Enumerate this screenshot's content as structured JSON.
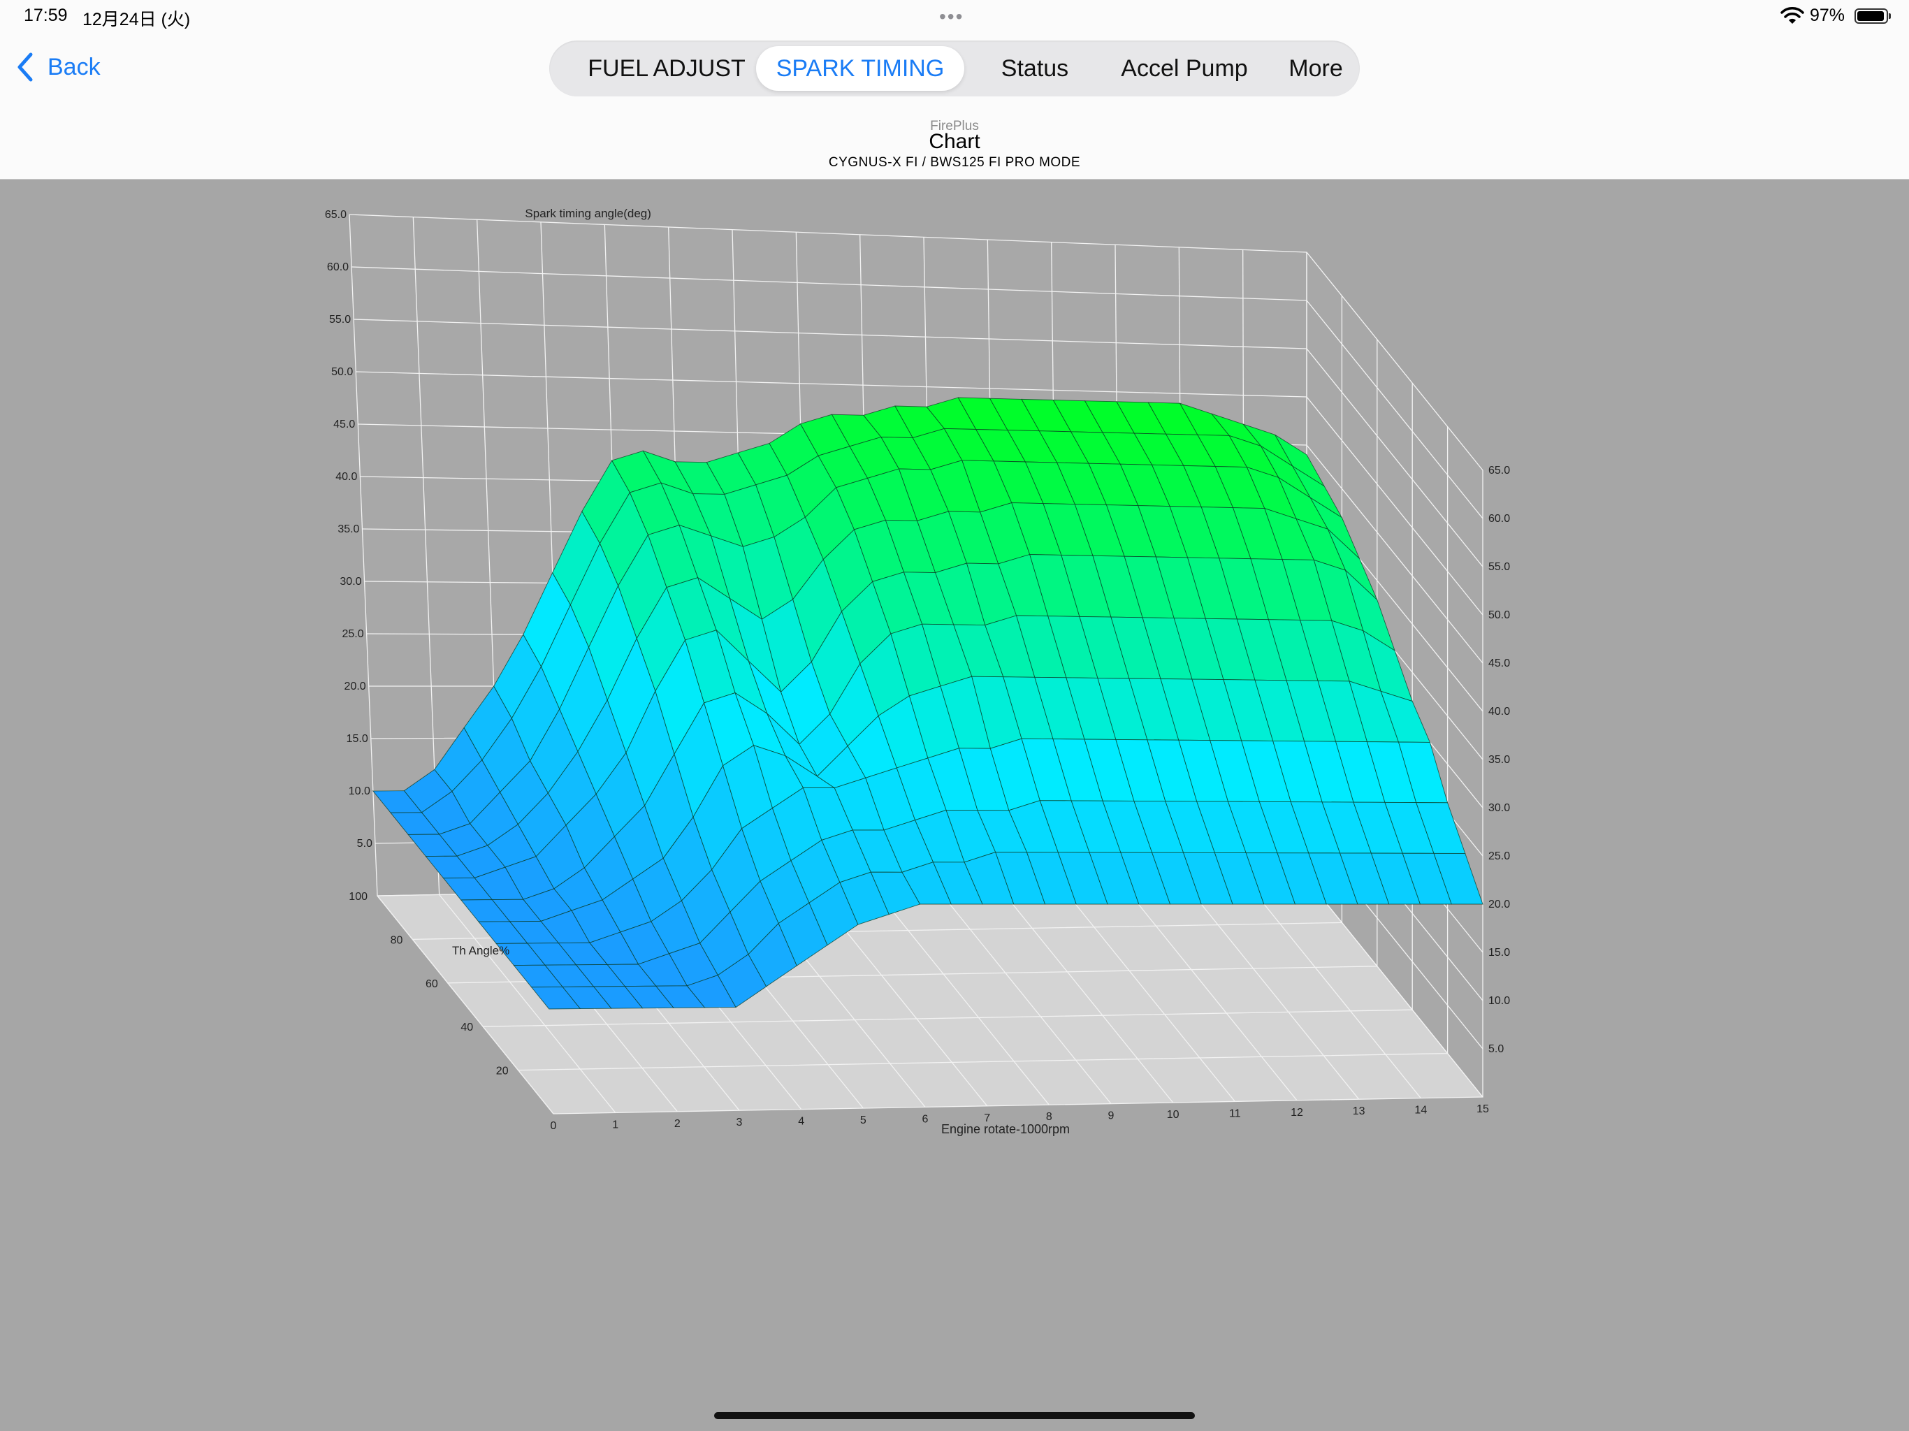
{
  "status_bar": {
    "time": "17:59",
    "date": "12月24日 (火)",
    "battery_percent": "97%",
    "dots": "•••",
    "wifi_icon": "wifi-icon",
    "battery_icon": "battery-icon"
  },
  "nav": {
    "back_label": "Back",
    "tabs": [
      {
        "label": "FUEL ADJUST",
        "active": false
      },
      {
        "label": "SPARK TIMING",
        "active": true
      },
      {
        "label": "Status",
        "active": false
      },
      {
        "label": "Accel Pump",
        "active": false
      },
      {
        "label": "More",
        "active": false
      }
    ],
    "app_name": "FirePlus",
    "title": "Chart",
    "subtitle": "CYGNUS-X FI / BWS125 FI PRO MODE"
  },
  "colors": {
    "accent": "#1a7cf5",
    "background": "#a6a6a6",
    "surface_low": "#1a9cff",
    "surface_high": "#00ff1a"
  },
  "chart_data": {
    "type": "surface3d",
    "title": "Spark timing angle(deg)",
    "xlabel": "Engine rotate-1000rpm",
    "ylabel": "Th Angle%",
    "zlabel": "Spark timing angle(deg)",
    "x_ticks": [
      "0",
      "1",
      "2",
      "3",
      "4",
      "5",
      "6",
      "7",
      "8",
      "9",
      "10",
      "11",
      "12",
      "13",
      "14",
      "15"
    ],
    "y_ticks": [
      "20",
      "40",
      "60",
      "80",
      "100"
    ],
    "z_ticks_left": [
      "5.0",
      "10.0",
      "15.0",
      "20.0",
      "25.0",
      "30.0",
      "35.0",
      "40.0",
      "45.0",
      "50.0",
      "55.0",
      "60.0",
      "65.0"
    ],
    "z_ticks_right": [
      "5.0",
      "10.0",
      "15.0",
      "20.0",
      "25.0",
      "30.0",
      "35.0",
      "40.0",
      "45.0",
      "50.0",
      "55.0",
      "60.0",
      "65.0"
    ],
    "xlim": [
      0,
      15
    ],
    "ylim": [
      0,
      100
    ],
    "zlim": [
      0,
      65
    ],
    "grid": true,
    "x": [
      0,
      0.5,
      1,
      1.5,
      2,
      2.5,
      3,
      3.5,
      4,
      4.5,
      5,
      5.5,
      6,
      6.5,
      7,
      7.5,
      8,
      8.5,
      9,
      9.5,
      10,
      10.5,
      11,
      11.5,
      12,
      12.5,
      13,
      13.5,
      14,
      14.5,
      15
    ],
    "y": [
      0,
      10,
      20,
      30,
      40,
      50,
      60,
      70,
      80,
      90,
      100
    ],
    "z": [
      [
        10,
        10,
        10,
        10,
        10,
        10,
        10,
        12,
        14,
        16,
        18,
        19,
        20,
        20,
        20,
        20,
        20,
        20,
        20,
        20,
        20,
        20,
        20,
        20,
        20,
        20,
        20,
        20,
        20,
        20,
        20
      ],
      [
        10,
        10,
        10,
        10,
        10,
        10,
        11,
        13,
        16,
        18,
        20,
        21,
        21,
        22,
        22,
        23,
        23,
        23,
        23,
        23,
        23,
        23,
        23,
        23,
        23,
        23,
        23,
        23,
        23,
        23,
        23
      ],
      [
        10,
        10,
        10,
        10,
        10,
        11,
        12,
        15,
        18,
        20,
        22,
        23,
        23,
        24,
        25,
        25,
        25,
        26,
        26,
        26,
        26,
        26,
        26,
        26,
        26,
        26,
        26,
        26,
        26,
        26,
        26
      ],
      [
        10,
        10,
        10,
        10,
        11,
        12,
        14,
        17,
        21,
        23,
        25,
        25,
        26,
        27,
        28,
        29,
        29,
        30,
        30,
        30,
        30,
        30,
        30,
        30,
        30,
        30,
        30,
        30,
        30,
        30,
        30
      ],
      [
        10,
        10,
        10,
        11,
        12,
        14,
        16,
        20,
        25,
        27,
        26,
        24,
        27,
        30,
        32,
        33,
        34,
        34,
        34,
        34,
        34,
        34,
        34,
        34,
        34,
        34,
        34,
        34,
        34,
        33,
        32
      ],
      [
        10,
        10,
        10,
        11,
        13,
        16,
        19,
        24,
        29,
        30,
        28,
        25,
        28,
        33,
        36,
        37,
        37,
        37,
        38,
        38,
        38,
        38,
        38,
        38,
        38,
        38,
        38,
        38,
        38,
        37,
        35
      ],
      [
        10,
        10,
        11,
        12,
        15,
        18,
        22,
        28,
        33,
        34,
        31,
        28,
        31,
        36,
        39,
        40,
        40,
        41,
        41,
        42,
        42,
        42,
        42,
        42,
        42,
        42,
        42,
        42,
        42,
        41,
        38
      ],
      [
        10,
        10,
        11,
        13,
        16,
        20,
        25,
        31,
        36,
        37,
        35,
        33,
        35,
        39,
        42,
        43,
        43,
        44,
        44,
        45,
        45,
        45,
        45,
        45,
        45,
        45,
        45,
        45,
        44,
        43,
        40
      ],
      [
        10,
        10,
        11,
        14,
        17,
        22,
        28,
        34,
        39,
        40,
        39,
        38,
        39,
        41,
        44,
        45,
        46,
        46,
        47,
        47,
        47,
        47,
        47,
        47,
        47,
        47,
        47,
        47,
        46,
        44,
        42
      ],
      [
        10,
        10,
        12,
        15,
        19,
        24,
        30,
        36,
        41,
        42,
        41,
        41,
        42,
        43,
        45,
        46,
        47,
        47,
        48,
        48,
        48,
        48,
        48,
        48,
        48,
        48,
        48,
        48,
        47,
        45,
        43
      ],
      [
        10,
        10,
        12,
        16,
        20,
        25,
        31,
        37,
        42,
        43,
        42,
        42,
        43,
        44,
        46,
        47,
        47,
        48,
        48,
        49,
        49,
        49,
        49,
        49,
        49,
        49,
        49,
        48,
        47,
        46,
        44
      ]
    ]
  }
}
